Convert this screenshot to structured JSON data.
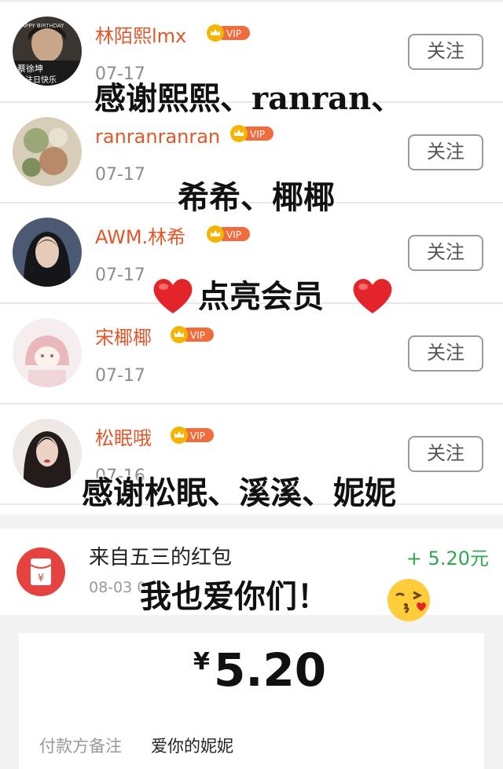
{
  "followers": [
    {
      "name": "林陌熙lmx",
      "badge": "VIP",
      "date": "07-17",
      "follow_label": "关注"
    },
    {
      "name": "ranranranran",
      "badge": "VIP",
      "date": "07-17",
      "follow_label": "关注"
    },
    {
      "name": "AWM.林希",
      "badge": "VIP",
      "date": "07-17",
      "follow_label": "关注"
    },
    {
      "name": "宋椰椰",
      "badge": "VIP",
      "date": "07-17",
      "follow_label": "关注"
    },
    {
      "name": "松眠哦",
      "badge": "VIP",
      "date": "07-16",
      "follow_label": "关注"
    }
  ],
  "avatar_texts": {
    "banner": "HAPPY BIRTHDAY",
    "name": "蔡徐坤",
    "caption": "关注日快乐"
  },
  "captions": {
    "line1": "感谢熙熙、ranran、",
    "line2": "希希、椰椰",
    "line3": "点亮会员",
    "line4": "感谢松眠、溪溪、妮妮",
    "line5": "我也爱你们！"
  },
  "red_packet": {
    "title": "来自五三的红包",
    "date": "08-03 0",
    "amount": "+ 5.20元",
    "icon": "red-envelope-icon",
    "icon_glyph": "¥"
  },
  "payment": {
    "currency": "¥",
    "amount": "5.20",
    "note_label": "付款方备注",
    "note_value": "爱你的妮妮"
  },
  "colors": {
    "username": "#e0572a",
    "vip_gold": "#f5b400",
    "vip_red": "#f06c3c",
    "amount_green": "#2fa84f",
    "red_packet": "#e64340",
    "heart": "#e3252b"
  }
}
